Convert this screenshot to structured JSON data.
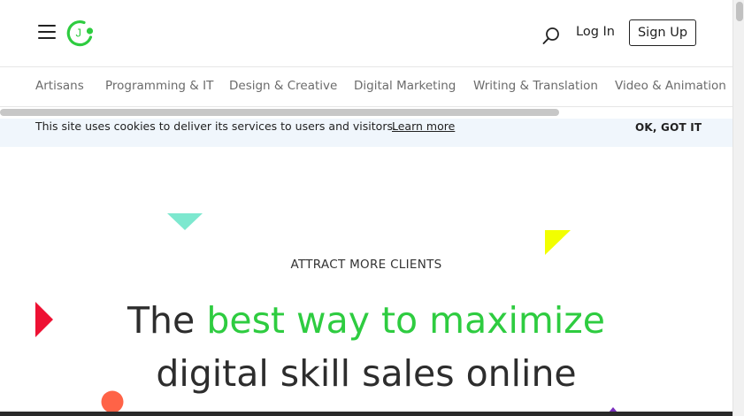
{
  "header": {
    "login_label": "Log In",
    "signup_label": "Sign Up",
    "logo_letter": "J"
  },
  "categories": [
    "Artisans",
    "Programming & IT",
    "Design & Creative",
    "Digital Marketing",
    "Writing & Translation",
    "Video & Animation"
  ],
  "cookie_banner": {
    "text": "This site uses cookies to deliver its services to users and visitors.",
    "link_label": "Learn more",
    "ok_label": "OK, GOT IT"
  },
  "hero": {
    "eyebrow": "ATTRACT MORE CLIENTS",
    "title_lead": "The",
    "title_accent": "best way to maximize",
    "title_rest": "digital skill sales online"
  },
  "colors": {
    "brand_green": "#2ecc40",
    "teal_triangle": "#7de8cf",
    "yellow_triangle": "#f2ff00",
    "red_triangle": "#ee1133",
    "orange_dot": "#ff6347"
  }
}
